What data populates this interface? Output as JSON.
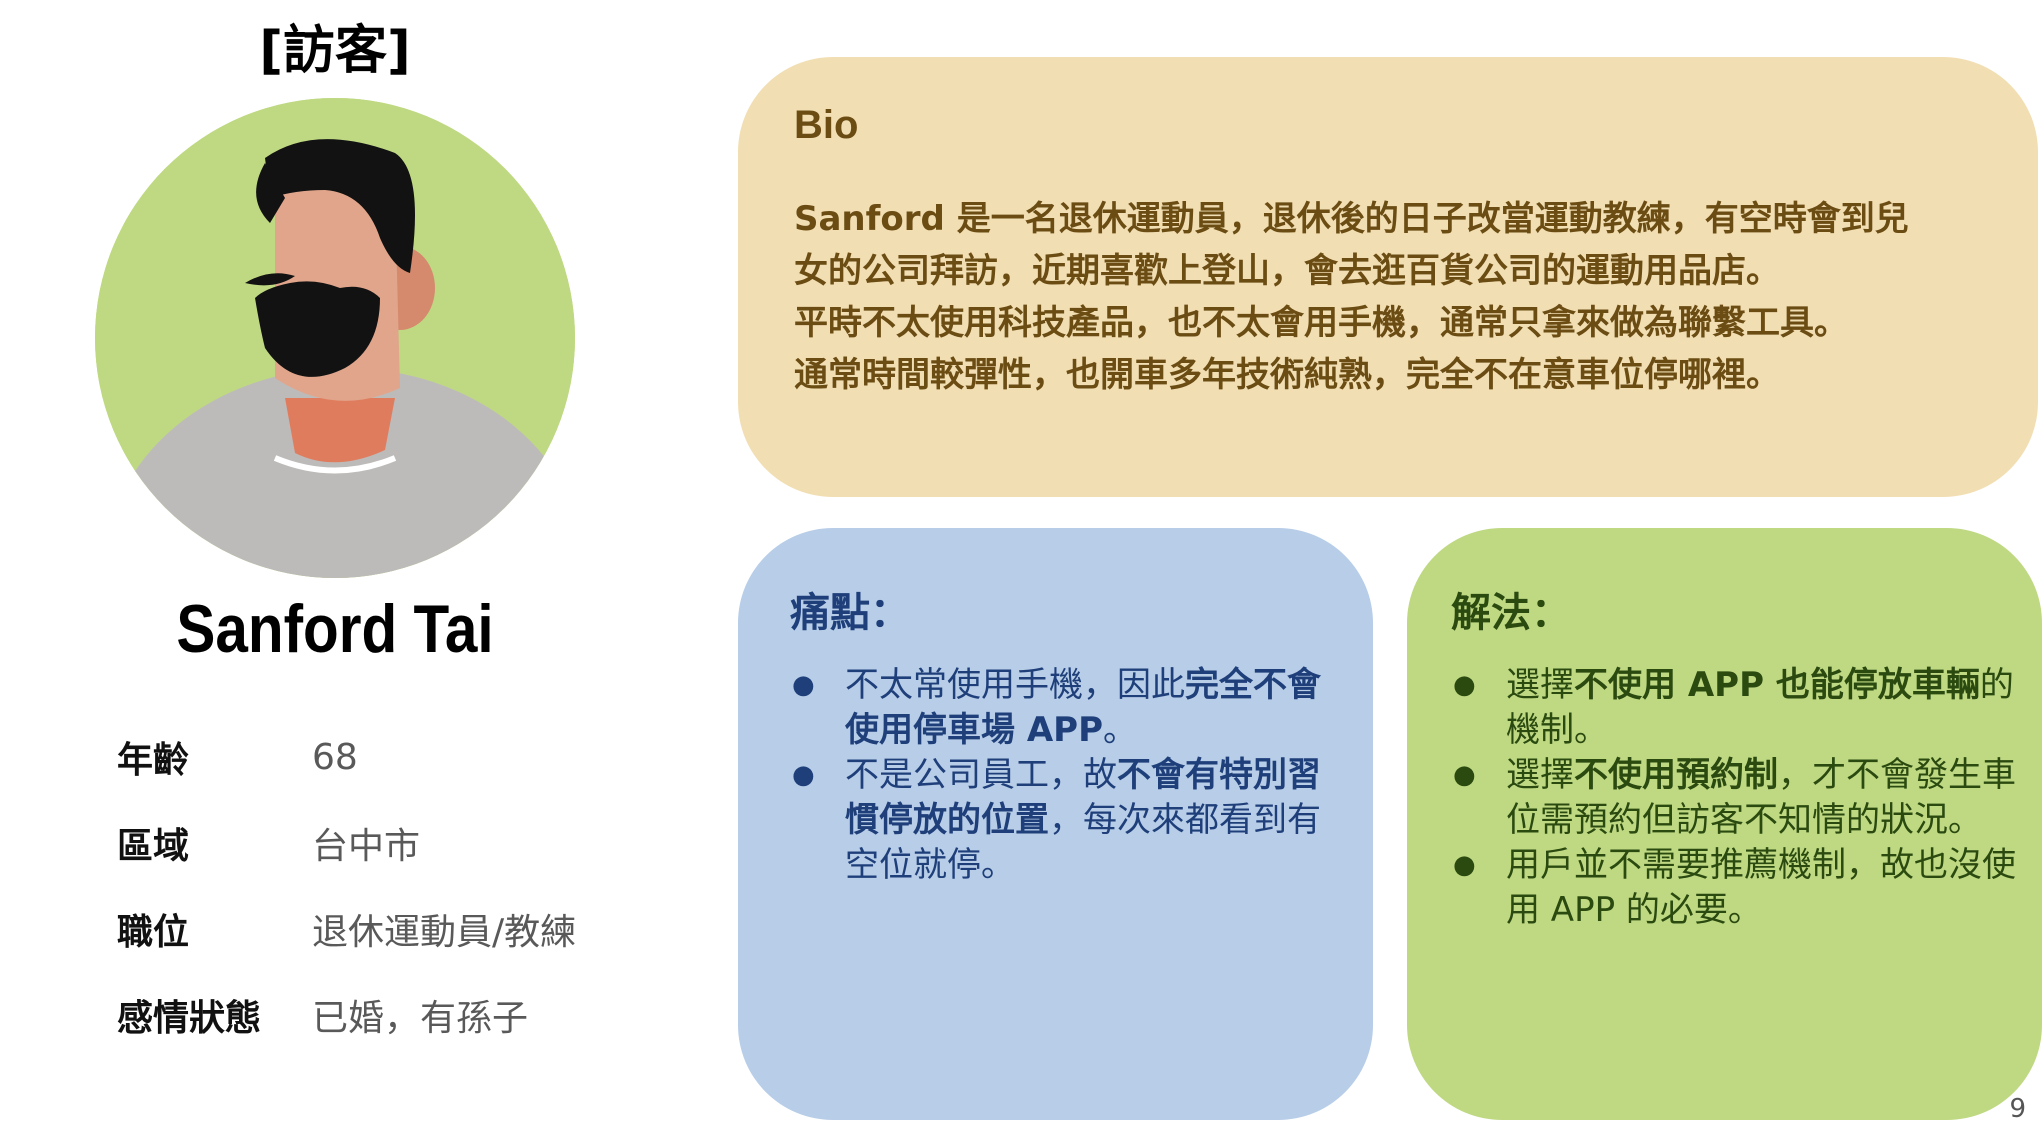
{
  "persona": {
    "role_title": "[訪客]",
    "name": "Sanford Tai",
    "avatar_icon": "man-avatar-icon",
    "info": [
      {
        "label": "年齡",
        "value": "68"
      },
      {
        "label": "區域",
        "value": "台中市"
      },
      {
        "label": "職位",
        "value": "退休運動員/教練"
      },
      {
        "label": "感情狀態",
        "value": "已婚，有孫子"
      }
    ]
  },
  "bio": {
    "heading": "Bio",
    "lines": [
      "Sanford 是一名退休運動員，退休後的日子改當運動教練，有空時會到兒",
      "女的公司拜訪，近期喜歡上登山，會去逛百貨公司的運動用品店。",
      "平時不太使用科技產品，也不太會用手機，通常只拿來做為聯繫工具。",
      "通常時間較彈性，也開車多年技術純熟，完全不在意車位停哪裡。"
    ]
  },
  "pain_points": {
    "heading": "痛點：",
    "items": [
      {
        "segments": [
          {
            "text": "不太常使用手機，因此",
            "bold": false
          },
          {
            "text": "完全不會使用停車場 APP",
            "bold": true
          },
          {
            "text": "。",
            "bold": false
          }
        ]
      },
      {
        "segments": [
          {
            "text": "不是公司員工，故",
            "bold": false
          },
          {
            "text": "不會有特別習慣停放的位置",
            "bold": true
          },
          {
            "text": "，每次來都看到有空位就停。",
            "bold": false
          }
        ]
      }
    ]
  },
  "solutions": {
    "heading": "解法：",
    "items": [
      {
        "segments": [
          {
            "text": "選擇",
            "bold": false
          },
          {
            "text": "不使用 APP 也能停放車輛",
            "bold": true
          },
          {
            "text": "的機制。",
            "bold": false
          }
        ]
      },
      {
        "segments": [
          {
            "text": "選擇",
            "bold": false
          },
          {
            "text": "不使用預約制",
            "bold": true
          },
          {
            "text": "，才不會發生車位需預約但訪客不知情的狀況。",
            "bold": false
          }
        ]
      },
      {
        "segments": [
          {
            "text": "用戶並不需要推薦機制，故也沒使用 APP 的必要。",
            "bold": false
          }
        ]
      }
    ]
  },
  "page_number": "9",
  "colors": {
    "bio_bg": "#f2deb3",
    "pain_bg": "#b7cde8",
    "solution_bg": "#bfd983",
    "avatar_bg": "#bfd983"
  }
}
